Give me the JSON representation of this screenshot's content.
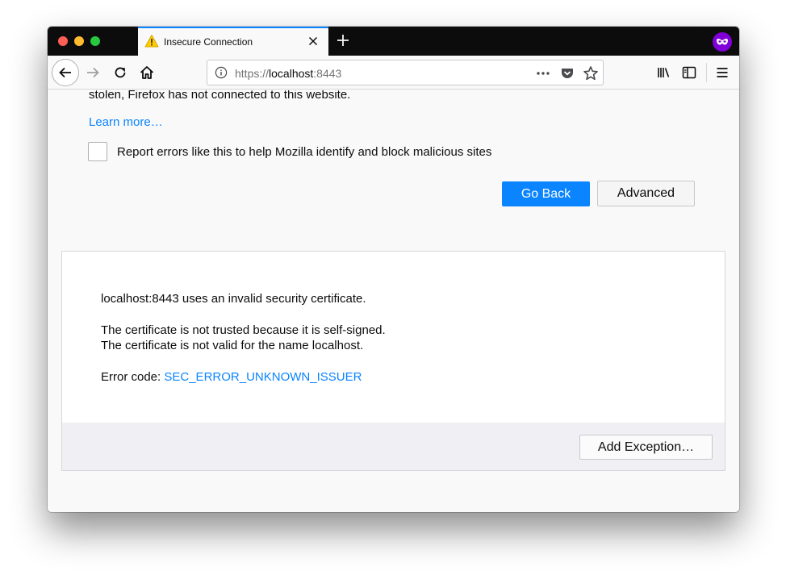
{
  "tab": {
    "title": "Insecure Connection"
  },
  "urlbar": {
    "scheme": "https://",
    "host": "localhost",
    "port": ":8443"
  },
  "page": {
    "intro_text": "stolen, Firefox has not connected to this website.",
    "learn_more": "Learn more…",
    "report_label": "Report errors like this to help Mozilla identify and block malicious sites",
    "go_back_label": "Go Back",
    "advanced_label": "Advanced"
  },
  "advanced_panel": {
    "line1": "localhost:8443 uses an invalid security certificate.",
    "line2": "The certificate is not trusted because it is self-signed.",
    "line3": "The certificate is not valid for the name localhost.",
    "error_code_prefix": "Error code: ",
    "error_code": "SEC_ERROR_UNKNOWN_ISSUER",
    "add_exception_label": "Add Exception…"
  },
  "colors": {
    "accent": "#0a84ff",
    "tabbar": "#0c0c0d",
    "private": "#8000d7",
    "warning": "#ffcc00"
  },
  "icons": {
    "tab": "warning-icon",
    "nav": [
      "back-arrow-icon",
      "forward-arrow-icon",
      "reload-icon",
      "home-icon"
    ],
    "urlbar": [
      "info-icon",
      "more-icon",
      "pocket-icon",
      "star-icon"
    ],
    "toolbar": [
      "library-icon",
      "sidebar-icon",
      "hamburger-menu-icon"
    ],
    "private": "private-browsing-icon"
  }
}
